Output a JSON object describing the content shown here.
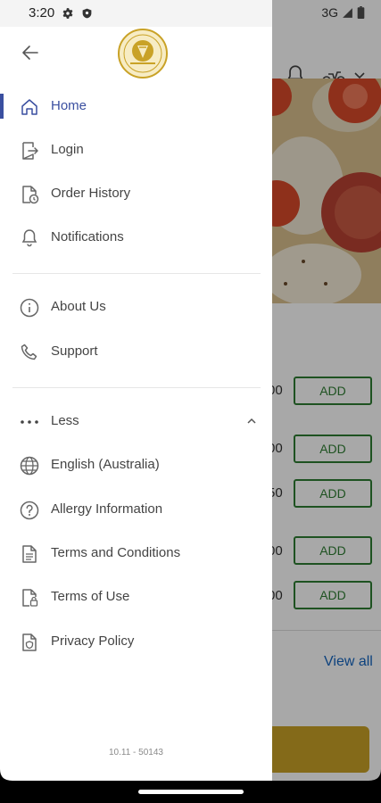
{
  "status_bar": {
    "time": "3:20",
    "network": "3G"
  },
  "background": {
    "prices": [
      "00",
      "00",
      "50",
      "00",
      "00"
    ],
    "add_label": "ADD",
    "view_all": "View all"
  },
  "drawer": {
    "menu_primary": [
      {
        "label": "Home",
        "icon": "home-icon",
        "active": true
      },
      {
        "label": "Login",
        "icon": "login-icon"
      },
      {
        "label": "Order History",
        "icon": "order-history-icon"
      },
      {
        "label": "Notifications",
        "icon": "bell-icon"
      }
    ],
    "menu_secondary": [
      {
        "label": "About Us",
        "icon": "info-icon"
      },
      {
        "label": "Support",
        "icon": "phone-icon"
      }
    ],
    "less_label": "Less",
    "menu_more": [
      {
        "label": "English (Australia)",
        "icon": "globe-icon"
      },
      {
        "label": "Allergy Information",
        "icon": "help-circle-icon"
      },
      {
        "label": "Terms and Conditions",
        "icon": "document-icon"
      },
      {
        "label": "Terms of Use",
        "icon": "document-lock-icon"
      },
      {
        "label": "Privacy Policy",
        "icon": "privacy-icon"
      }
    ],
    "version": "10.11 - 50143"
  },
  "colors": {
    "accent": "#3a4fa0",
    "add_green": "#2e7d32",
    "cart_gold": "#c9a227",
    "logo_gold": "#c9a227"
  }
}
